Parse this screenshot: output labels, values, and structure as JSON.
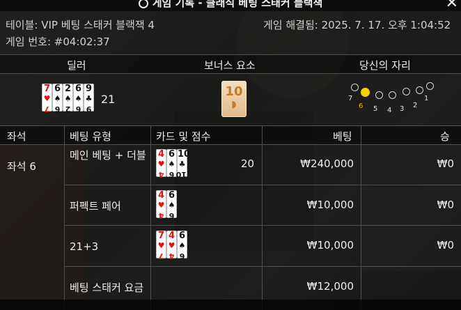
{
  "window": {
    "title": "게임 기록 - 클래식 베팅 스태커 블랙잭",
    "close_glyph": "✕"
  },
  "info": {
    "table": "테이블: VIP 베팅 스태커 블랙잭 4",
    "resolved": "게임 해결됨: 2025. 7. 17. 오후 1:04:52",
    "game_id": "게임 번호: #04:02:37"
  },
  "section_headers": {
    "dealer": "딜러",
    "bonus": "보너스 요소",
    "seat": "당신의 자리"
  },
  "dealer": {
    "cards": [
      {
        "rank": "7",
        "suit": "♥",
        "red": true
      },
      {
        "rank": "6",
        "suit": "♠",
        "red": false
      },
      {
        "rank": "2",
        "suit": "♠",
        "red": false
      },
      {
        "rank": "6",
        "suit": "♠",
        "red": false
      },
      {
        "rank": "9",
        "suit": "♣",
        "red": false
      }
    ],
    "score": "21"
  },
  "bonus": {
    "value": "10"
  },
  "seats": {
    "labels": [
      "7",
      "6",
      "5",
      "4",
      "3",
      "2",
      "1"
    ],
    "selected": "6"
  },
  "table": {
    "headers": {
      "seat": "좌석",
      "bet_type": "베팅 유형",
      "cards_score": "카드 및 점수",
      "bet": "베팅",
      "win": "승"
    },
    "seat_label": "좌석 6",
    "rows": [
      {
        "type": "메인 베팅 + 더블",
        "cards": [
          {
            "rank": "4",
            "suit": "♥",
            "red": true
          },
          {
            "rank": "6",
            "suit": "♠",
            "red": false
          },
          {
            "rank": "10",
            "suit": "♣",
            "red": false
          }
        ],
        "score": "20",
        "bet": "₩240,000",
        "win": "₩0"
      },
      {
        "type": "퍼펙트 페어",
        "cards": [
          {
            "rank": "4",
            "suit": "♥",
            "red": true
          },
          {
            "rank": "6",
            "suit": "♠",
            "red": false
          }
        ],
        "score": "",
        "bet": "₩10,000",
        "win": "₩0"
      },
      {
        "type": "21+3",
        "cards": [
          {
            "rank": "7",
            "suit": "♥",
            "red": true
          },
          {
            "rank": "4",
            "suit": "♥",
            "red": true
          },
          {
            "rank": "6",
            "suit": "♠",
            "red": false
          }
        ],
        "score": "",
        "bet": "₩10,000",
        "win": "₩0"
      },
      {
        "type": "베팅 스태커 요금",
        "cards": [],
        "score": "",
        "bet": "₩12,000",
        "win": ""
      }
    ]
  }
}
